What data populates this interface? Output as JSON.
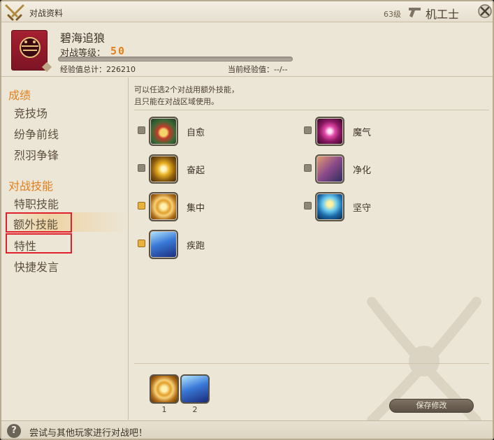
{
  "window": {
    "title": "对战资料",
    "level": "63级",
    "job": "机工士",
    "job_icon": "machinist-job-icon",
    "close_icon": "close-icon"
  },
  "header": {
    "player_name": "碧海追狼",
    "rank_label": "对战等级：",
    "rank_value": "50",
    "exp_progress": 0.0,
    "exp_total": "经验值总计：226210",
    "exp_current": "当前经验值：--/--"
  },
  "sidebar": {
    "achievements_title": "成绩",
    "achievements": [
      {
        "label": "竞技场"
      },
      {
        "label": "纷争前线"
      },
      {
        "label": "烈羽争锋"
      }
    ],
    "skills_title": "对战技能",
    "skills": [
      {
        "label": "特职技能"
      },
      {
        "label": "额外技能"
      },
      {
        "label": "特性"
      },
      {
        "label": "快捷发言"
      }
    ],
    "highlight_color": "#e0202a",
    "accent_color": "#e2801c"
  },
  "main": {
    "hint_line1": "可以任选2个对战用额外技能，",
    "hint_line2": "且只能在对战区域使用。",
    "skills": [
      {
        "label": "自愈",
        "checked": false,
        "icon": "recuperate-icon"
      },
      {
        "label": "魔气",
        "checked": false,
        "icon": "mana-icon"
      },
      {
        "label": "奋起",
        "checked": false,
        "icon": "rampart-icon"
      },
      {
        "label": "净化",
        "checked": false,
        "icon": "purify-icon"
      },
      {
        "label": "集中",
        "checked": true,
        "icon": "focus-icon"
      },
      {
        "label": "坚守",
        "checked": false,
        "icon": "guard-icon"
      },
      {
        "label": "疾跑",
        "checked": true,
        "icon": "sprint-icon"
      }
    ],
    "slots": [
      {
        "num": "1",
        "icon": "focus-icon"
      },
      {
        "num": "2",
        "icon": "sprint-icon"
      }
    ],
    "save_label": "保存修改"
  },
  "status": {
    "help_glyph": "?",
    "text": "尝试与其他玩家进行对战吧！"
  }
}
